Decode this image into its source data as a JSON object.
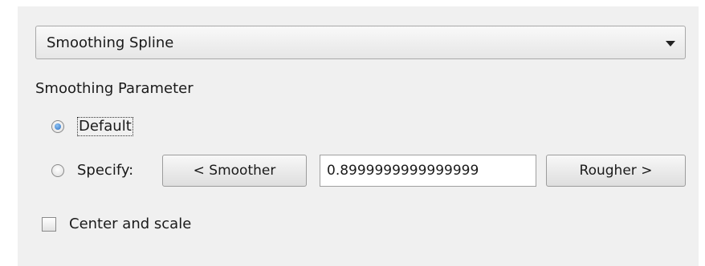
{
  "fit_type": {
    "selected": "Smoothing Spline",
    "icon": "chevron-down-icon"
  },
  "smoothing": {
    "section_title": "Smoothing Parameter",
    "default_label": "Default",
    "default_checked": true,
    "specify_label": "Specify:",
    "specify_checked": false,
    "smoother_label": "< Smoother",
    "value": "0.8999999999999999",
    "rougher_label": "Rougher >"
  },
  "options": {
    "center_scale_label": "Center and scale",
    "center_scale_checked": false
  }
}
